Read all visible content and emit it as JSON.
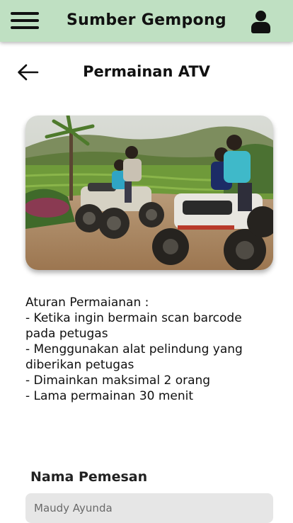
{
  "app": {
    "title": "Sumber Gempong",
    "header_bg": "#bfe0c2"
  },
  "icons": {
    "menu": "hamburger-menu-icon",
    "user": "user-profile-icon",
    "back": "back-arrow-icon"
  },
  "page": {
    "title": "Permainan ATV"
  },
  "rules": {
    "heading": "Aturan Permaianan :",
    "items": [
      "- Ketika ingin bermain scan barcode pada petugas",
      "- Menggunakan alat pelindung yang diberikan petugas",
      "- Dimainkan maksimal 2 orang",
      "- Lama permainan 30 menit"
    ]
  },
  "form": {
    "name_label": "Nama Pemesan",
    "name_value": "Maudy Ayunda"
  }
}
